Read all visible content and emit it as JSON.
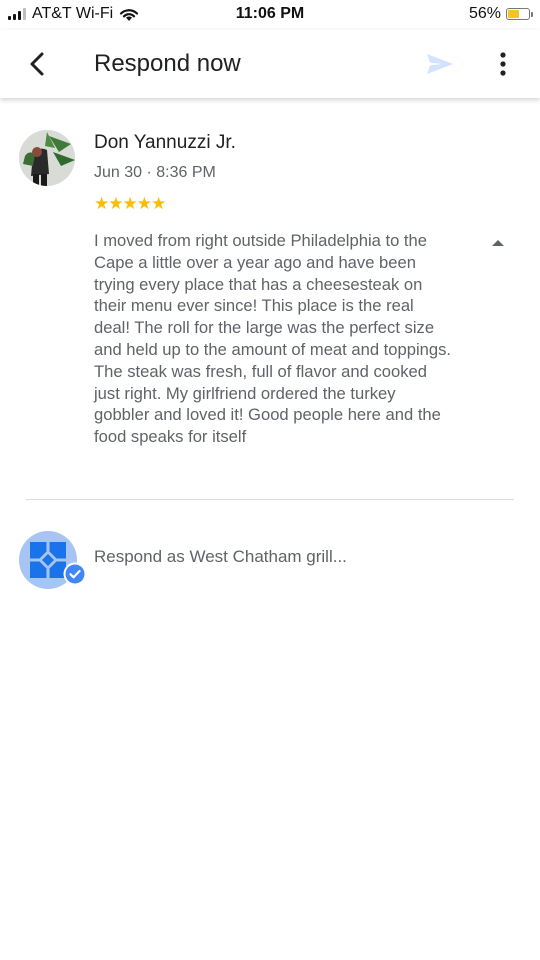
{
  "status": {
    "carrier": "AT&T Wi-Fi",
    "time": "11:06 PM",
    "battery_percent": "56%",
    "battery_level": 0.56,
    "battery_color": "#f5c518"
  },
  "header": {
    "title": "Respond now",
    "back_icon": "chevron-left-icon",
    "send_icon": "send-icon",
    "more_icon": "more-vert-icon"
  },
  "review": {
    "reviewer_name": "Don Yannuzzi Jr.",
    "date": "Jun 30 · 8:36 PM",
    "rating": 5,
    "stars": "★★★★★",
    "star_color": "#fbbc04",
    "text": "I moved from right outside Philadelphia to the Cape a little over a year ago and have been trying every place that has a cheesesteak on their menu ever since! This place is the real deal! The roll for the large was the perfect size and held up to the amount of meat and toppings. The steak was fresh, full of flavor and cooked just right. My girlfriend ordered the turkey gobbler and loved it! Good people here and the food speaks for itself"
  },
  "response": {
    "placeholder": "Respond as West Chatham grill...",
    "value": "",
    "avatar_icon": "business-profile-icon",
    "verified_icon": "verified-check-icon",
    "accent_color": "#4285f4"
  }
}
